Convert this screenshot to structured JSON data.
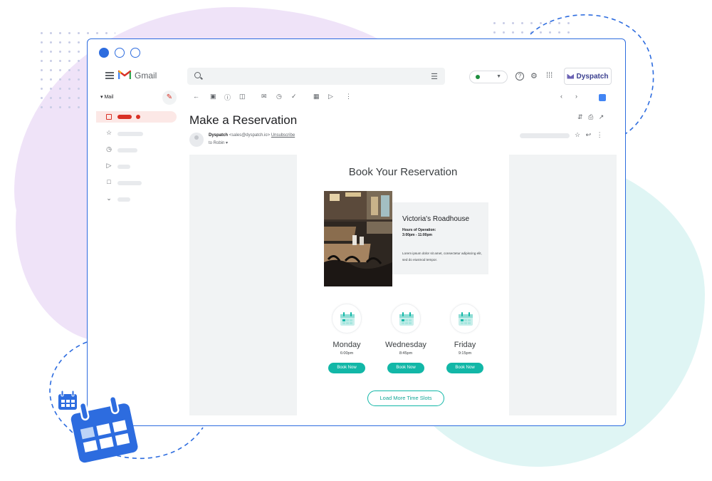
{
  "app": {
    "name": "Gmail",
    "brand_badge": "Dyspatch"
  },
  "colors": {
    "accent_blue": "#2d6cdf",
    "teal_button": "#12b7a7",
    "gmail_red": "#d93025",
    "online_green": "#1e8e3e"
  },
  "sidebar": {
    "mail_label": "Mail",
    "icons": [
      "inbox-icon",
      "star-icon",
      "clock-icon",
      "send-icon",
      "draft-icon",
      "more-chevron-icon"
    ]
  },
  "toolbar": {
    "icons": [
      "back-arrow-icon",
      "archive-icon",
      "report-spam-icon",
      "delete-icon",
      "mark-unread-icon",
      "snooze-icon",
      "add-task-icon",
      "move-to-icon",
      "label-icon",
      "more-icon",
      "prev-icon",
      "next-icon"
    ]
  },
  "message": {
    "subject": "Make a Reservation",
    "sender_name": "Dyspatch",
    "sender_email": "<sales@dyspatch.io>",
    "unsubscribe": "Unsubscribe",
    "to": "to Robin"
  },
  "email": {
    "heading": "Book Your Reservation",
    "restaurant": {
      "name": "Victoria's Roadhouse",
      "hours_label": "Hours of Operation:",
      "hours_value": "3:00pm - 11:00pm",
      "description": "Lorem ipsum dolor sit amet, consectetur adipiscing elit, sed do eiusmod tempor."
    },
    "slots": [
      {
        "day": "Monday",
        "time": "6:00pm",
        "button": "Book Now"
      },
      {
        "day": "Wednesday",
        "time": "8:45pm",
        "button": "Book Now"
      },
      {
        "day": "Friday",
        "time": "9:15pm",
        "button": "Book Now"
      }
    ],
    "load_more": "Load More Time Slots"
  }
}
